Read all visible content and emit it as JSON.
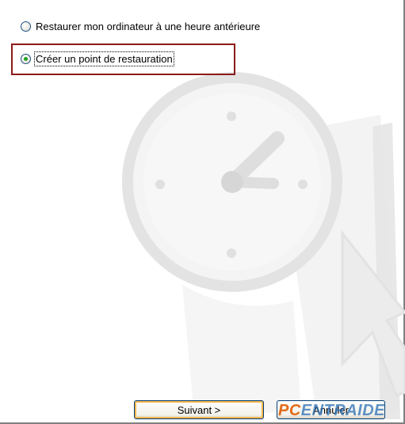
{
  "options": [
    {
      "label": "Restaurer mon ordinateur à une heure antérieure",
      "selected": false
    },
    {
      "label": "Créer un point de restauration",
      "selected": true
    }
  ],
  "buttons": {
    "next_label": "Suivant >",
    "cancel_label": "Annuler"
  },
  "watermark": {
    "part1": "PC",
    "part2": "ENTRAIDE"
  },
  "colors": {
    "highlight_border": "#8b1a1a",
    "radio_dot": "#21a121",
    "button_border": "#003c74",
    "default_button_glow": "#f6b64d",
    "watermark_orange": "#e46b1a",
    "watermark_blue": "#2a6fb5"
  },
  "icons": {
    "background": "clock-icon",
    "cursor_art": "arrow-icon"
  }
}
